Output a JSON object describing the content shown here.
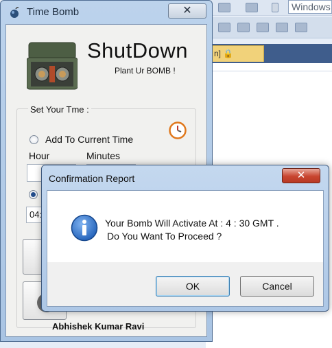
{
  "background_ide": {
    "search_box_text": "Windows",
    "tab_text": "n] 🔒"
  },
  "time_bomb_window": {
    "title": "Time Bomb",
    "close_glyph": "✕",
    "app_title": "ShutDown",
    "subtitle": "Plant Ur BOMB !",
    "group_label": "Set Your Tme :",
    "add_to_current_label": "Add To Current Time",
    "hour_label": "Hour",
    "minutes_label": "Minutes",
    "time_field_value": "04:",
    "author": "Abhishek Kumar Ravi"
  },
  "dialog": {
    "title": "Confirmation Report",
    "close_glyph": "✕",
    "message_line1": "Your Bomb Will Activate At : 4 : 30 GMT .",
    "message_line2": "Do You Want To Proceed ?",
    "ok_label": "OK",
    "cancel_label": "Cancel"
  },
  "colors": {
    "window_frame": "#a9c4e3",
    "dialog_close_red": "#c8452f",
    "info_icon_blue": "#1f5fb8",
    "clock_orange": "#e0781c"
  }
}
